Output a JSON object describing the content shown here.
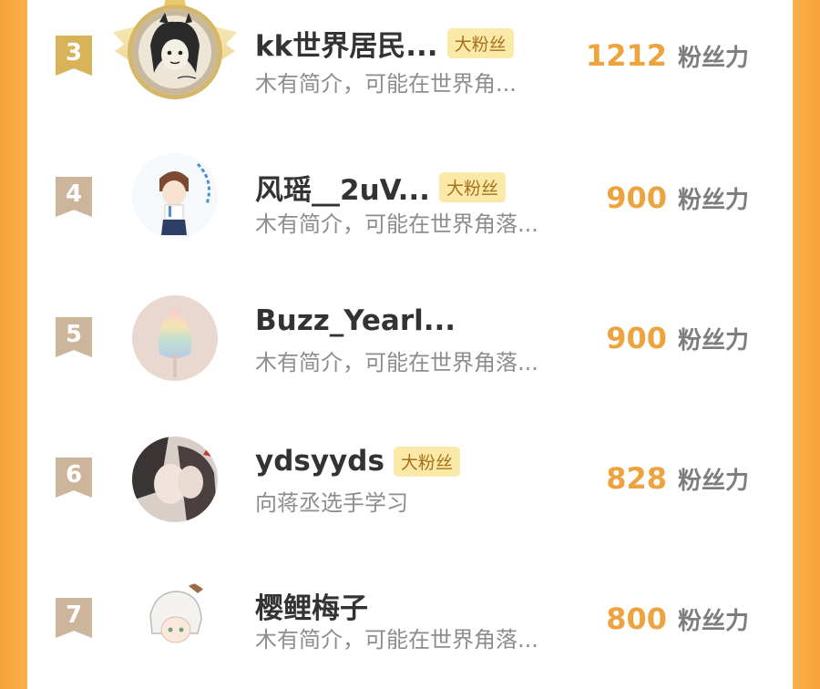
{
  "leaderboard": {
    "rows": [
      {
        "rank": "3",
        "name": "kk世界居民...",
        "badge": "大粉丝",
        "desc": "木有简介，可能在世界角...",
        "score": "1212",
        "unit": "粉丝力"
      },
      {
        "rank": "4",
        "name": "风瑶__2uV...",
        "badge": "大粉丝",
        "desc": "木有简介，可能在世界角落...",
        "score": "900",
        "unit": "粉丝力"
      },
      {
        "rank": "5",
        "name": "Buzz_Yearl...",
        "badge": "",
        "desc": "木有简介，可能在世界角落...",
        "score": "900",
        "unit": "粉丝力"
      },
      {
        "rank": "6",
        "name": "ydsyyds",
        "badge": "大粉丝",
        "desc": "向蒋丞选手学习",
        "score": "828",
        "unit": "粉丝力"
      },
      {
        "rank": "7",
        "name": "樱鲤梅子",
        "badge": "",
        "desc": "木有简介，可能在世界角落...",
        "score": "800",
        "unit": "粉丝力"
      }
    ]
  },
  "colors": {
    "accent_orange": "#eda33e",
    "border_orange": "#f7a23b",
    "badge_bg": "#fbe9a8",
    "rank_gold": "#d9b35a",
    "rank_bronze": "#cdb59c"
  }
}
